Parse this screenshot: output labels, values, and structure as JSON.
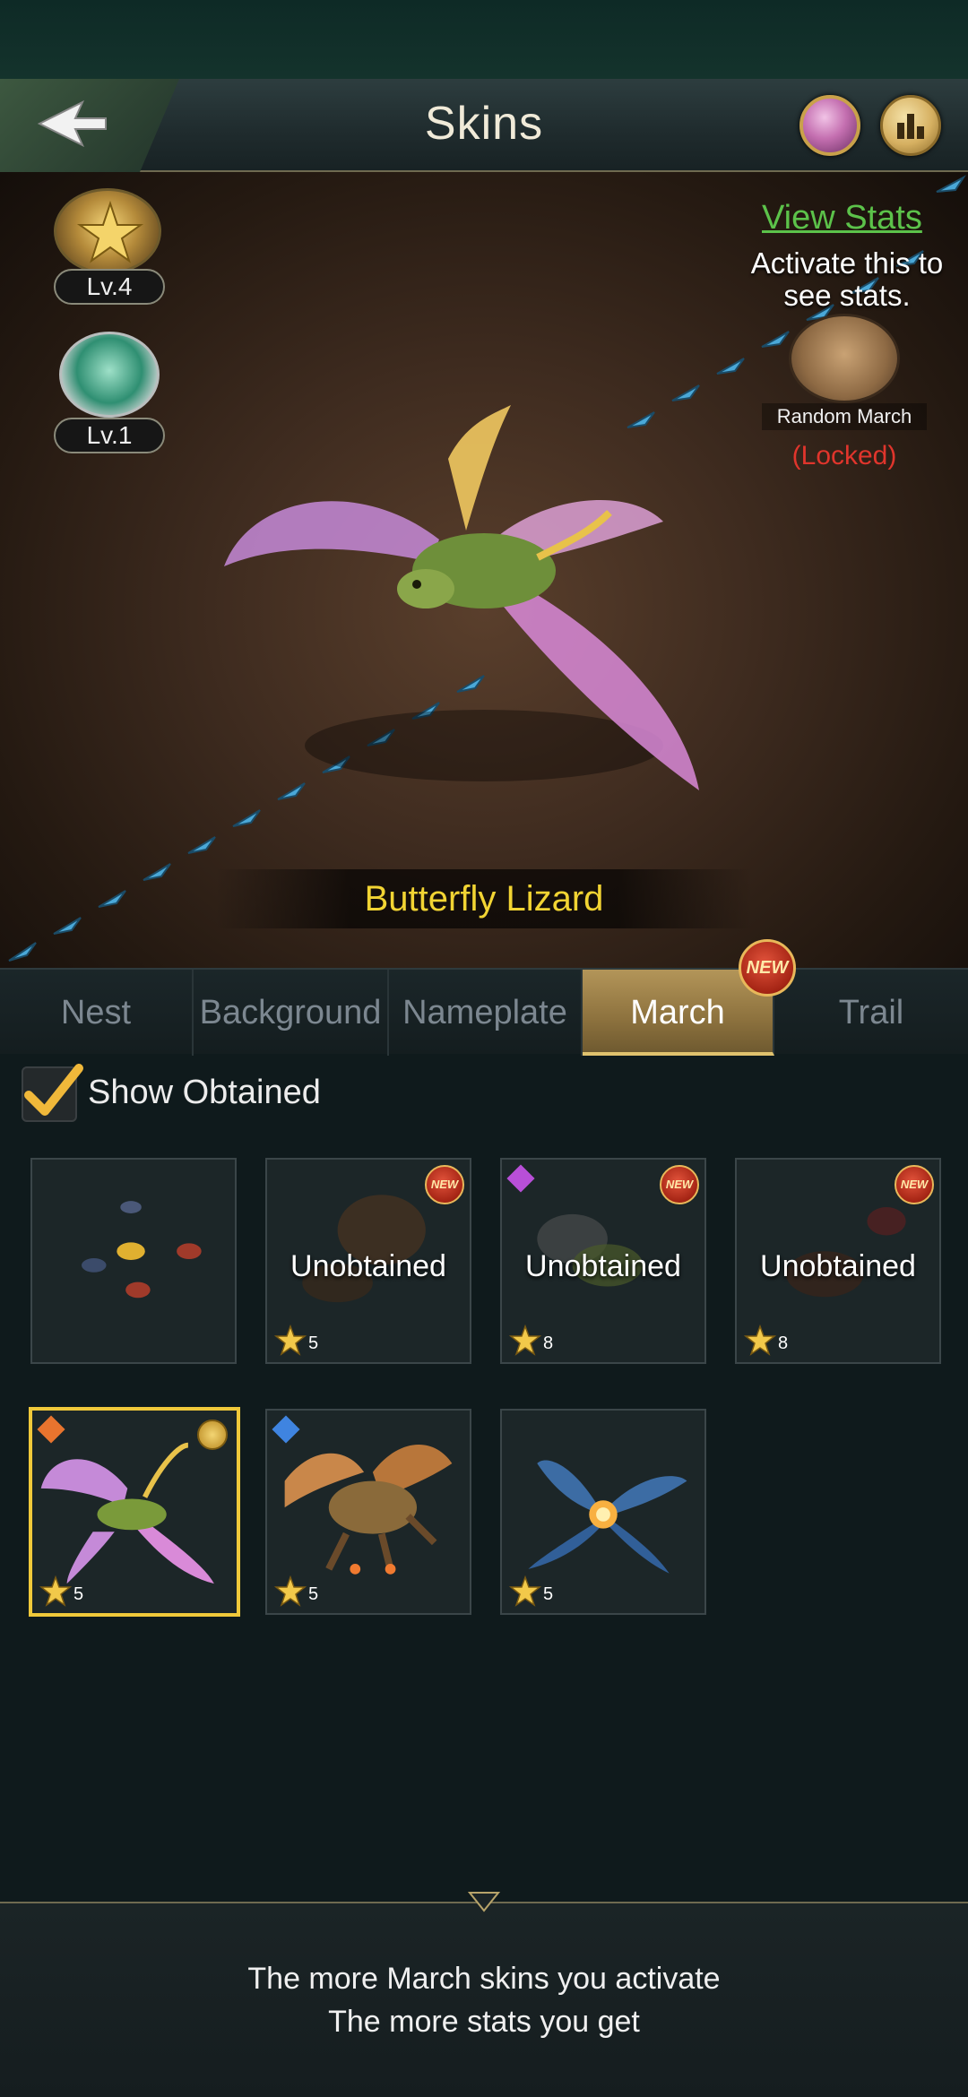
{
  "header": {
    "title": "Skins",
    "back_icon": "back-arrow-icon",
    "gem_icon": "pink-gem-icon",
    "rank_icon": "ranking-icon"
  },
  "showcase": {
    "badges": [
      {
        "icon": "star-medal-icon",
        "level": "Lv.4"
      },
      {
        "icon": "winged-crest-icon",
        "level": "Lv.1"
      }
    ],
    "view_stats": "View Stats",
    "activate_text": "Activate this to see stats.",
    "random_march": {
      "icon": "ant-march-icon",
      "label": "Random March",
      "status": "(Locked)"
    },
    "skin_name": "Butterfly Lizard"
  },
  "tabs": [
    {
      "label": "Nest",
      "active": false
    },
    {
      "label": "Background",
      "active": false
    },
    {
      "label": "Nameplate",
      "active": false
    },
    {
      "label": "March",
      "active": true,
      "badge": "NEW"
    },
    {
      "label": "Trail",
      "active": false
    }
  ],
  "filter": {
    "show_obtained_label": "Show Obtained",
    "checked": true
  },
  "skins": [
    {
      "id": "ants",
      "status": "",
      "stars": "",
      "new": false
    },
    {
      "id": "spider",
      "status": "Unobtained",
      "stars": "5",
      "new": true,
      "new_label": "NEW"
    },
    {
      "id": "wasp",
      "status": "Unobtained",
      "stars": "8",
      "new": true,
      "new_label": "NEW",
      "gem_color": "#b84fd8"
    },
    {
      "id": "beetle",
      "status": "Unobtained",
      "stars": "8",
      "new": true,
      "new_label": "NEW"
    },
    {
      "id": "butterfly-lizard",
      "status": "",
      "stars": "5",
      "new": false,
      "selected": true,
      "gem_color": "#e8742e"
    },
    {
      "id": "dragon",
      "status": "",
      "stars": "5",
      "new": false,
      "gem_color": "#3f84e0"
    },
    {
      "id": "firefly",
      "status": "",
      "stars": "5",
      "new": false
    }
  ],
  "footer": {
    "line1": "The more March skins you activate",
    "line2": "The more stats you get"
  },
  "colors": {
    "accent_gold": "#f0c93a",
    "link_green": "#5cc24a",
    "locked_red": "#e0352c",
    "name_yellow": "#f2d433"
  }
}
